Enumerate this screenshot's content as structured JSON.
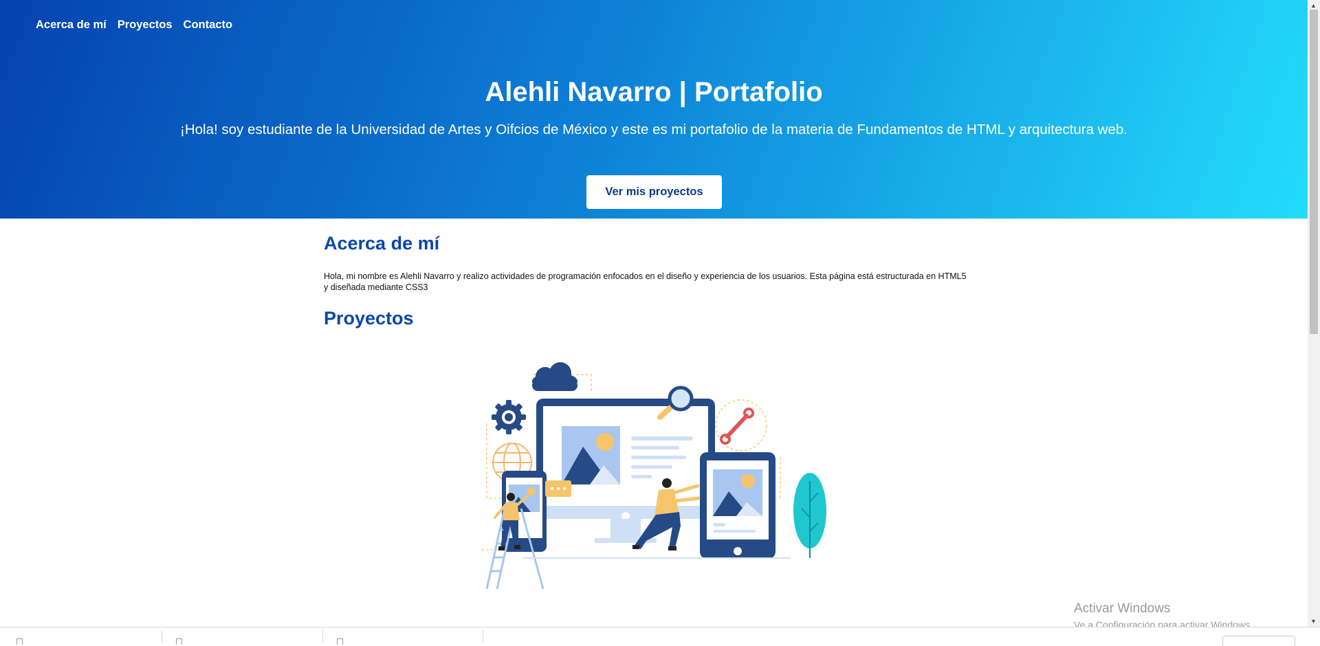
{
  "nav": {
    "items": [
      "Acerca de mí",
      "Proyectos",
      "Contacto"
    ]
  },
  "hero": {
    "title": "Alehli Navarro | Portafolio",
    "intro": "¡Hola! soy estudiante de la Universidad de Artes y Oifcios de México y este es mi portafolio de la materia de Fundamentos de HTML y arquitectura web.",
    "button_label": "Ver mis proyectos"
  },
  "about": {
    "heading": "Acerca de mí",
    "text": "Hola, mi nombre es Alehli Navarro y realizo actividades de programación enfocados en el diseño y experiencia de los usuarios. Esta página está estructurada en HTML5 y diseñada mediante CSS3"
  },
  "projects": {
    "heading": "Proyectos",
    "illustration": "web-development-illustration"
  },
  "watermark": {
    "line1": "Activar Windows",
    "line2": "Ve a Configuración para activar Windows."
  },
  "colors": {
    "hero_gradient_start": "#0542b0",
    "hero_gradient_end": "#23dcfc",
    "heading": "#0c47a8",
    "button_text": "#0b3a8a"
  }
}
